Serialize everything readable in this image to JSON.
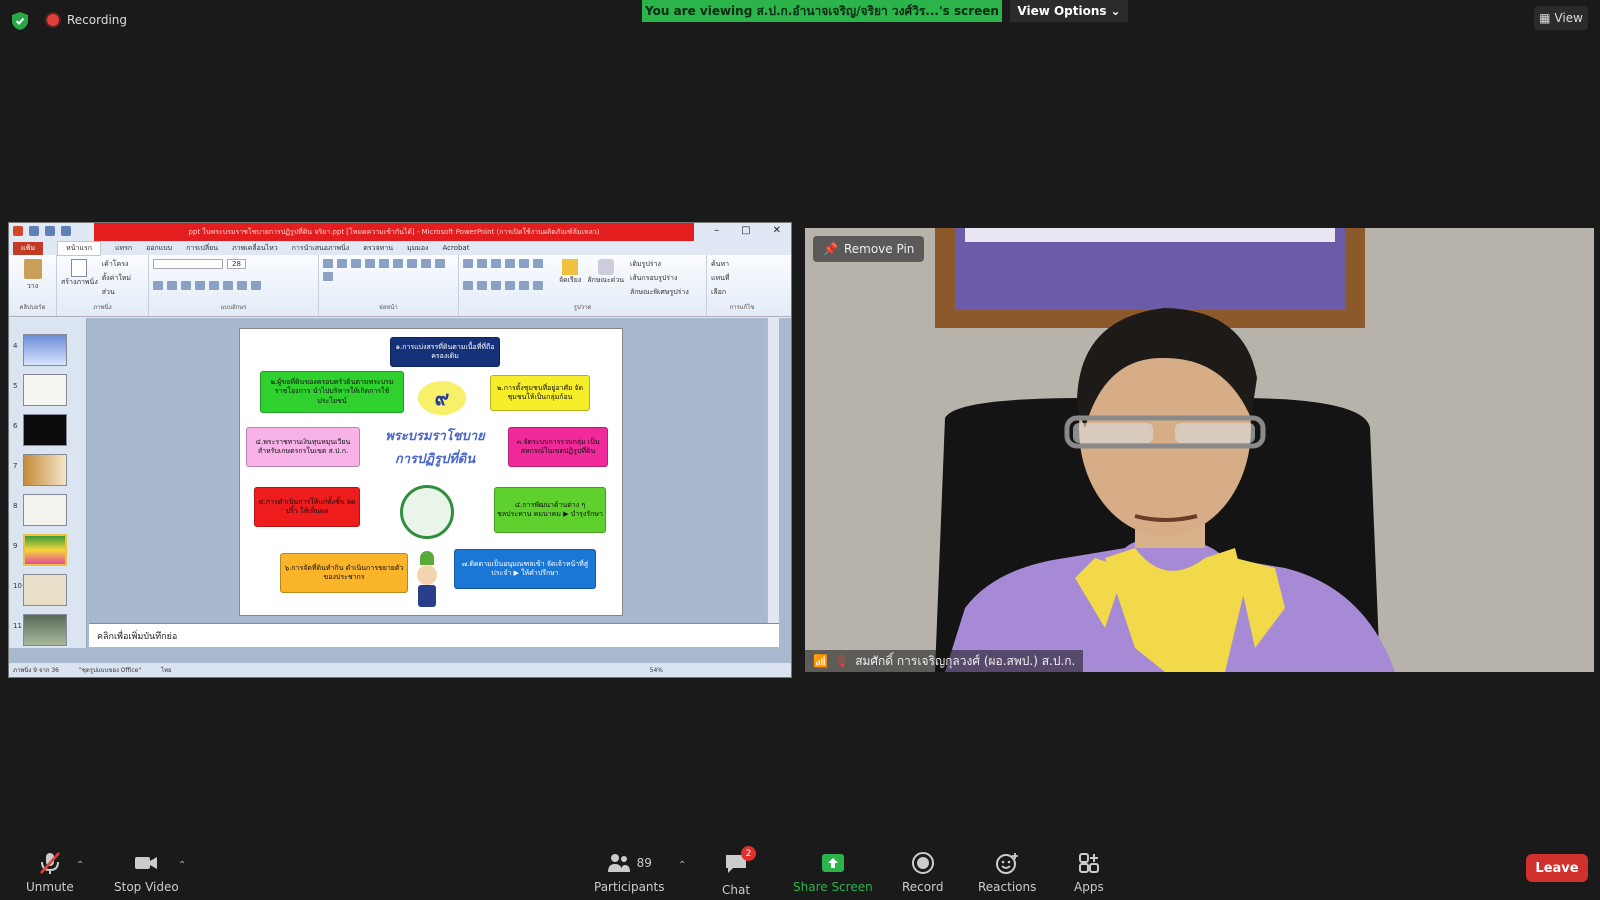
{
  "topbar": {
    "recording_label": "Recording",
    "viewing_banner": "You are viewing ส.ป.ก.อำนาจเจริญ/จริยา วงศ์วิร...'s screen",
    "view_options_label": "View Options",
    "view_label": "View"
  },
  "shared_screen": {
    "window_title": "ppt ในพระบรมราชโชบายการปฏิรูปที่ดิน จริยา.ppt [โหมดความเข้ากันได้] - Microsoft PowerPoint (การเปิดใช้งานผลิตภัณฑ์ล้มเหลว)",
    "ribbon_tabs": [
      "แฟ้ม",
      "หน้าแรก",
      "แทรก",
      "ออกแบบ",
      "การเปลี่ยน",
      "ภาพเคลื่อนไหว",
      "การนำเสนอภาพนิ่ง",
      "ตรวจทาน",
      "มุมมอง",
      "Acrobat"
    ],
    "ribbon_groups": [
      "คลิปบอร์ด",
      "ภาพนิ่ง",
      "แบบอักษร",
      "ย่อหน้า",
      "รูปวาด",
      "การแก้ไข"
    ],
    "ribbon_buttons": {
      "paste": "วาง",
      "new_slide": "สร้างภาพนิ่ง",
      "layout": "เค้าโครง",
      "reset": "ตั้งค่าใหม่",
      "section": "ส่วน",
      "arrange": "จัดเรียง",
      "quick_styles": "ลักษณะด่วน",
      "shape_fill": "เติมรูปร่าง",
      "shape_outline": "เส้นกรอบรูปร่าง",
      "shape_effects": "ลักษณะพิเศษรูปร่าง",
      "find": "ค้นหา",
      "replace": "แทนที่",
      "select": "เลือก",
      "font_size": "28"
    },
    "thumb_numbers": [
      "4",
      "5",
      "6",
      "7",
      "8",
      "9",
      "10",
      "11"
    ],
    "slide": {
      "center_number": "๙",
      "title_line1": "พระบรมราโชบาย",
      "title_line2": "การปฏิรูปที่ดิน",
      "boxes": {
        "top": "๑.การแบ่งสรรที่ดินตามเนื้อที่ที่ถือครองเดิม",
        "left1": "๒.ผู้ขอที่ดินของครอบครัวดินตามพระบรมราชโองการ นำไปบริหารให้เกิดการใช้ประโยชน์",
        "right1": "๒.การตั้งชุมชนที่อยู่อาศัย จัดชุมชนให้เป็นกลุ่มก้อน",
        "left2": "๔.พระราชทานเงินทุนหมุนเวียน สำหรับเกษตรกรในเขต ส.ป.ก.",
        "right2": "๓.จัดระบบการรวบกลุ่ม เป็นสหกรณ์ในเขตปฏิรูปที่ดิน",
        "left3": "๕.การดำเนินการให้แก่ทั้งชั้น ลดปริ้ว ให้เห็นผล",
        "right3": "๔.การพัฒนาด้านต่าง ๆ ชลประทาน คมนาคม ▶ บำรุงรักษา",
        "bottom_left": "๖.การจัดที่ดินทำกิน ดำเนินการขยายตัวของประชากร",
        "bottom_right": "๗.ติดตามเป็นอนุมณฑลเข้า จัดเจ้าหน้าที่สู่ประจำ ▶ ให้คำปรึกษา"
      }
    },
    "notes_placeholder": "คลิกเพื่อเพิ่มบันทึกย่อ",
    "status": {
      "slide_of": "ภาพนิ่ง 9 จาก 36",
      "theme": "\"ชุดรูปแบบของ Office\"",
      "language": "ไทย",
      "zoom": "54%"
    }
  },
  "video": {
    "remove_pin_label": "Remove Pin",
    "participant_name": "สมศักดิ์ การเจริญกุลวงศ์ (ผอ.สพป.) ส.ป.ก."
  },
  "toolbar": {
    "unmute_label": "Unmute",
    "stop_video_label": "Stop Video",
    "participants_label": "Participants",
    "participants_count": "89",
    "chat_label": "Chat",
    "chat_badge": "2",
    "share_screen_label": "Share Screen",
    "record_label": "Record",
    "reactions_label": "Reactions",
    "apps_label": "Apps",
    "leave_label": "Leave"
  },
  "colors": {
    "accent_green": "#2ab44a",
    "leave_red": "#d0312d",
    "background": "#1a1a1a"
  }
}
